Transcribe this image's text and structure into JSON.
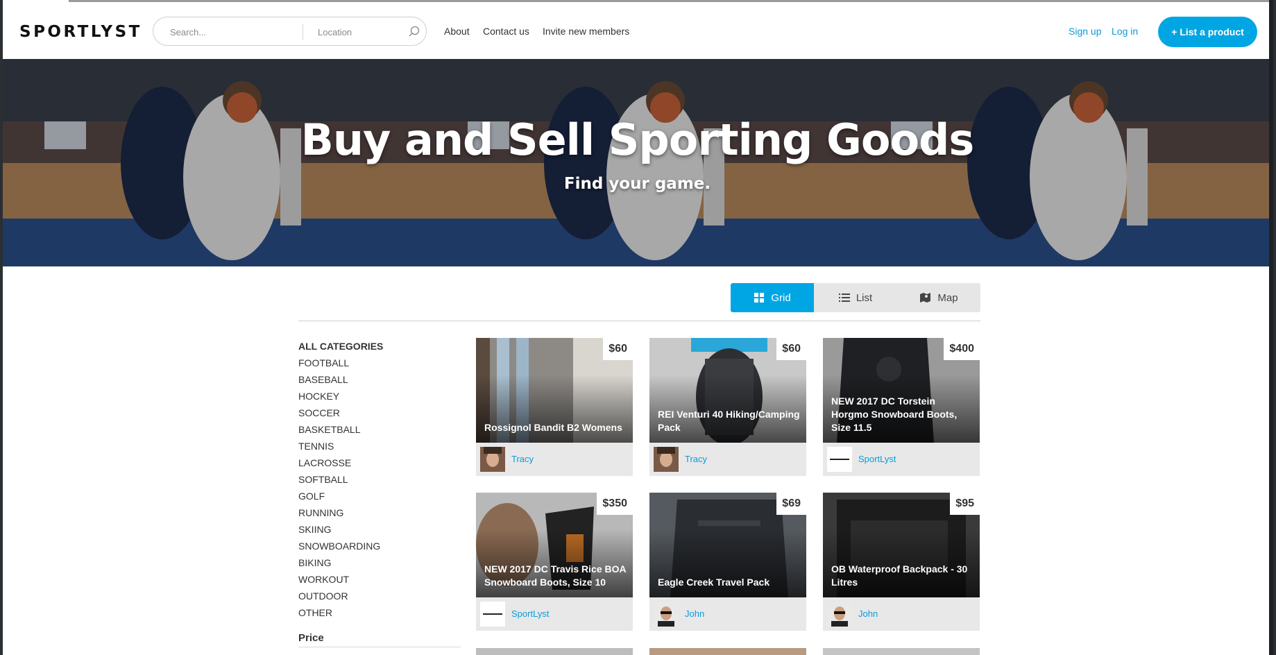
{
  "header": {
    "logo": "SPORTLYST",
    "search_placeholder": "Search...",
    "location_placeholder": "Location",
    "nav": [
      "About",
      "Contact us",
      "Invite new members"
    ],
    "signup": "Sign up",
    "login": "Log in",
    "cta": "+ List a product"
  },
  "hero": {
    "title": "Buy and Sell Sporting Goods",
    "subtitle": "Find your game."
  },
  "view_toggle": {
    "grid": "Grid",
    "list": "List",
    "map": "Map",
    "active": "grid"
  },
  "sidebar": {
    "all": "ALL CATEGORIES",
    "categories": [
      "FOOTBALL",
      "BASEBALL",
      "HOCKEY",
      "SOCCER",
      "BASKETBALL",
      "TENNIS",
      "LACROSSE",
      "SOFTBALL",
      "GOLF",
      "RUNNING",
      "SKIING",
      "SNOWBOARDING",
      "BIKING",
      "WORKOUT",
      "OUTDOOR",
      "OTHER"
    ],
    "price_label": "Price"
  },
  "listings": [
    {
      "title": "Rossignol Bandit B2 Womens",
      "price": "$60",
      "author": "Tracy"
    },
    {
      "title": "REI Venturi 40 Hiking/Camping Pack",
      "price": "$60",
      "author": "Tracy"
    },
    {
      "title": "NEW 2017 DC Torstein Horgmo Snowboard Boots, Size 11.5",
      "price": "$400",
      "author": "SportLyst"
    },
    {
      "title": "NEW 2017 DC Travis Rice BOA Snowboard Boots, Size 10",
      "price": "$350",
      "author": "SportLyst"
    },
    {
      "title": "Eagle Creek Travel Pack",
      "price": "$69",
      "author": "John"
    },
    {
      "title": "OB Waterproof Backpack - 30 Litres",
      "price": "$95",
      "author": "John"
    }
  ],
  "colors": {
    "accent": "#00a6e3",
    "link": "#0a9bd9",
    "text": "#333333"
  }
}
